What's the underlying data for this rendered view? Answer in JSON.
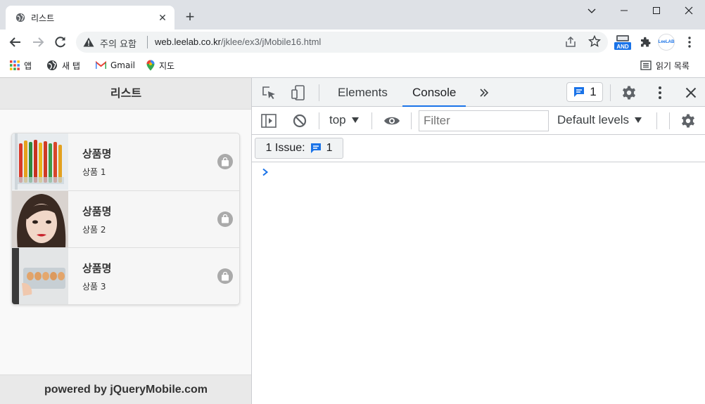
{
  "tab": {
    "title": "리스트",
    "close": "✕",
    "new_tab": "+"
  },
  "window": {
    "minimize": "minimize",
    "maximize": "maximize",
    "close": "close"
  },
  "omnibox": {
    "security_label": "주의 요함",
    "url_host": "web.leelab.co.kr",
    "url_path": "/jklee/ex3/jMobile16.html"
  },
  "extensions": {
    "and_label": "AND",
    "leelab_label": "LeeLAB"
  },
  "bookmarks": [
    {
      "label": "앱",
      "icon": "apps-grid-icon"
    },
    {
      "label": "새 탭",
      "icon": "globe-icon"
    },
    {
      "label": "Gmail",
      "icon": "gmail-icon"
    },
    {
      "label": "지도",
      "icon": "maps-pin-icon"
    }
  ],
  "reading_list": "읽기 목록",
  "page": {
    "header": "리스트",
    "items": [
      {
        "heading": "상품명",
        "sub": "상품 1",
        "thumb": "ice-pops"
      },
      {
        "heading": "상품명",
        "sub": "상품 2",
        "thumb": "woman-portrait"
      },
      {
        "heading": "상품명",
        "sub": "상품 3",
        "thumb": "egg-tray"
      }
    ],
    "footer": "powered by jQueryMobile.com"
  },
  "devtools": {
    "tabs": [
      "Elements",
      "Console"
    ],
    "active_tab": "Console",
    "message_count": "1",
    "context": "top",
    "filter_placeholder": "Filter",
    "levels": "Default levels",
    "issues_label": "1 Issue:",
    "issues_count": "1",
    "prompt": "›"
  },
  "colors": {
    "accent": "#1a73e8",
    "tabstrip": "#dee1e6",
    "jqm_bar": "#e9e9e9"
  }
}
